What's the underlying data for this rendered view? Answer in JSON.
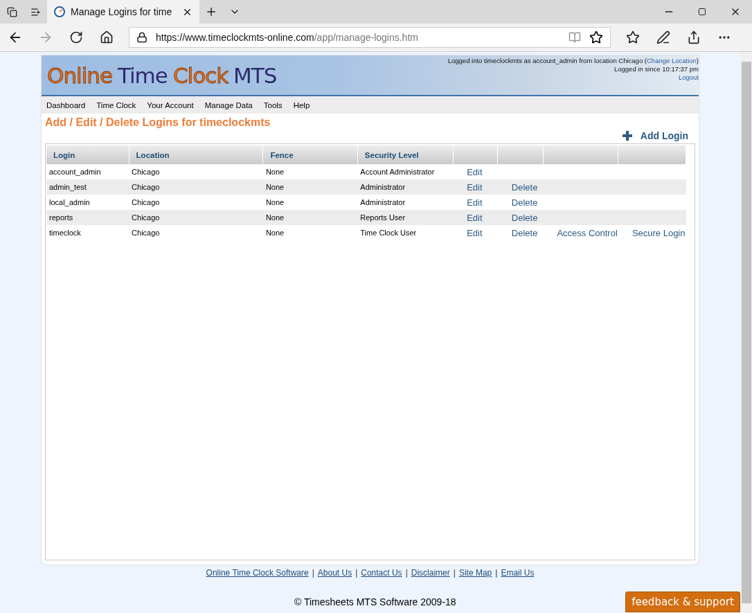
{
  "browser": {
    "tab_title": "Manage Logins for time",
    "url_host": "https://www.timeclockmts-online.com",
    "url_path": "/app/manage-logins.htm"
  },
  "header": {
    "logo": [
      {
        "text": "Online",
        "kind": "accent"
      },
      {
        "text": "Time",
        "kind": "dark"
      },
      {
        "text": "Clock",
        "kind": "accent"
      },
      {
        "text": "MTS",
        "kind": "dark"
      }
    ],
    "status_text": "Logged into timeclockmts as account_admin from location Chicago (",
    "change_location": "Change Location",
    "status_close": ")",
    "since": "Logged in since 10:17:37 pm",
    "logout": "Logout"
  },
  "menu": [
    "Dashboard",
    "Time Clock",
    "Your Account",
    "Manage Data",
    "Tools",
    "Help"
  ],
  "page_title": "Add / Edit / Delete Logins for timeclockmts",
  "add_login": "Add Login",
  "table": {
    "columns": [
      "Login",
      "Location",
      "Fence",
      "Security Level"
    ],
    "rows": [
      {
        "cells": [
          "account_admin",
          "Chicago",
          "None",
          "Account Administrator"
        ],
        "actions": [
          "Edit"
        ]
      },
      {
        "cells": [
          "admin_test",
          "Chicago",
          "None",
          "Administrator"
        ],
        "actions": [
          "Edit",
          "Delete"
        ]
      },
      {
        "cells": [
          "local_admin",
          "Chicago",
          "None",
          "Administrator"
        ],
        "actions": [
          "Edit",
          "Delete"
        ]
      },
      {
        "cells": [
          "reports",
          "Chicago",
          "None",
          "Reports User"
        ],
        "actions": [
          "Edit",
          "Delete"
        ]
      },
      {
        "cells": [
          "timeclock",
          "Chicago",
          "None",
          "Time Clock User"
        ],
        "actions": [
          "Edit",
          "Delete",
          "Access Control",
          "Secure Login"
        ]
      }
    ]
  },
  "footer_links": [
    "Online Time Clock Software",
    "About Us",
    "Contact Us",
    "Disclaimer",
    "Site Map",
    "Email Us"
  ],
  "footer_separators": [
    "|",
    "|",
    "|",
    "|",
    "|"
  ],
  "copyright": "© Timesheets MTS Software 2009-18",
  "feedback": "feedback & support"
}
